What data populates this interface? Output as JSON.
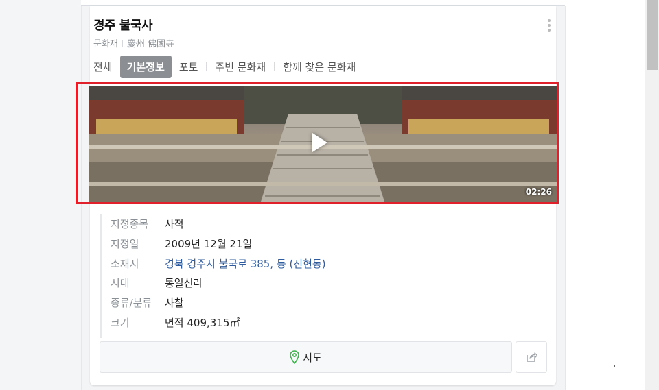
{
  "header": {
    "title": "경주 불국사",
    "category": "문화재",
    "hanja_name": "慶州 佛國寺"
  },
  "tabs": [
    {
      "label": "전체",
      "active": false
    },
    {
      "label": "기본정보",
      "active": true
    },
    {
      "label": "포토",
      "active": false
    },
    {
      "label": "주변 문화재",
      "active": false
    },
    {
      "label": "함께 찾은 문화재",
      "active": false
    }
  ],
  "video": {
    "duration": "02:26"
  },
  "info": [
    {
      "label": "지정종목",
      "value": "사적"
    },
    {
      "label": "지정일",
      "value": "2009년 12월 21일"
    },
    {
      "label": "소재지",
      "value": "경북 경주시 불국로 385, 등 (진현동)",
      "is_link": true
    },
    {
      "label": "시대",
      "value": "통일신라"
    },
    {
      "label": "종류/분류",
      "value": "사찰"
    },
    {
      "label": "크기",
      "value": "면적 409,315㎡"
    }
  ],
  "actions": {
    "map_label": "지도"
  },
  "colors": {
    "highlight": "#e0202a",
    "link": "#2f5c9e",
    "active_tab": "#8b8f94",
    "map_pin": "#3cb44b"
  },
  "icons": {
    "more": "more-vertical-icon",
    "play": "play-icon",
    "map_pin": "map-pin-icon",
    "share": "share-icon"
  }
}
